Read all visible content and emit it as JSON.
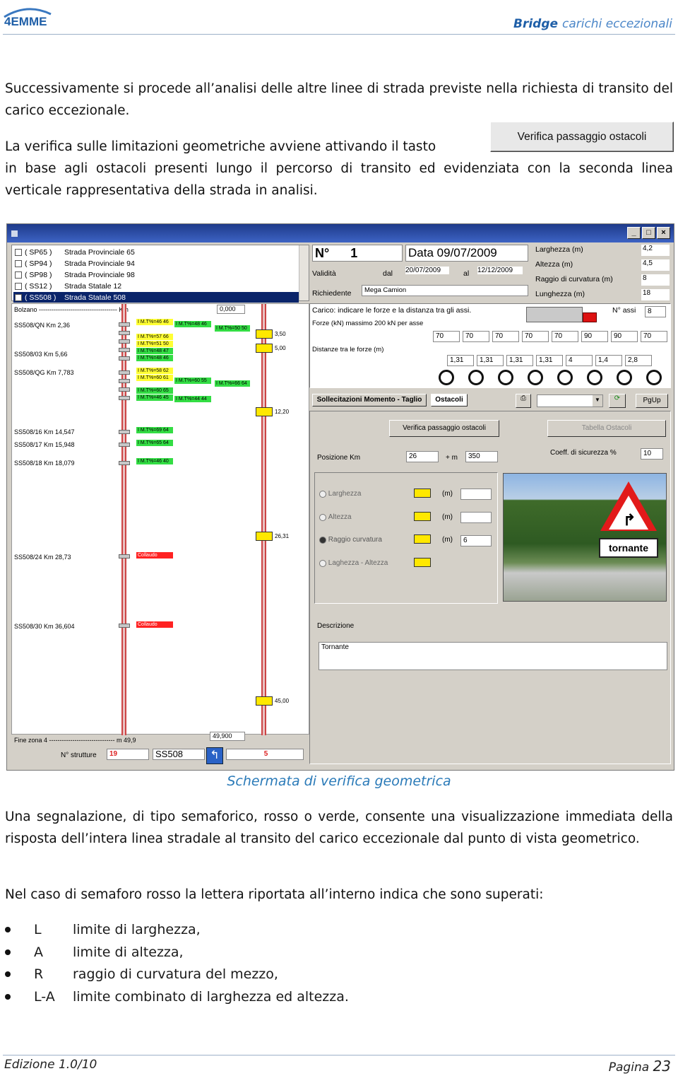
{
  "header": {
    "logo": "4EMME",
    "title_brand": "Bridge",
    "title_rest": "carichi eccezionali"
  },
  "body": {
    "p1": "Successivamente si procede all’analisi delle altre linee di strada previste nella richiesta di transito del carico eccezionale.",
    "p2a": "La verifica sulle limitazioni geometriche avviene attivando il tasto",
    "p2b": "in base agli ostacoli presenti lungo il percorso di transito ed evidenziata con la seconda linea verticale rappresentativa della strada in analisi.",
    "button_image_label": "Verifica passaggio ostacoli",
    "caption": "Schermata di verifica geometrica",
    "p3": "Una segnalazione, di tipo semaforico, rosso o verde, consente una visualizzazione immediata della risposta dell’intera linea stradale al transito del carico eccezionale dal punto di vista geometrico.",
    "p4": "Nel caso di semaforo rosso la lettera riportata all’interno indica che sono superati:",
    "bullets": [
      {
        "key": "L",
        "text": "limite di larghezza,"
      },
      {
        "key": "A",
        "text": "limite di altezza,"
      },
      {
        "key": "R",
        "text": "raggio di curvatura del mezzo,"
      },
      {
        "key": "L-A",
        "text": "limite combinato di larghezza ed altezza."
      }
    ]
  },
  "footer": {
    "edition": "Edizione 1.0/10",
    "page_label": "Pagina",
    "page_num": "23"
  },
  "screenshot": {
    "roads": [
      {
        "code": "( SP65 )",
        "name": "Strada Provinciale 65",
        "checked": false
      },
      {
        "code": "( SP94 )",
        "name": "Strada Provinciale 94",
        "checked": false
      },
      {
        "code": "( SP98 )",
        "name": "Strada Provinciale 98",
        "checked": false
      },
      {
        "code": "( SS12 )",
        "name": "Strada Statale 12",
        "checked": false
      },
      {
        "code": "( SS508 )",
        "name": "Strada Statale 508",
        "checked": true
      }
    ],
    "n_label": "N°",
    "n_value": "1",
    "data_label": "Data",
    "data_value": "09/07/2009",
    "validita": "Validità",
    "dal": "dal",
    "dal_value": "20/07/2009",
    "al": "al",
    "al_value": "12/12/2009",
    "richiedente": "Richiedente",
    "richiedente_value": "Mega Camion",
    "dims": [
      {
        "label": "Larghezza (m)",
        "value": "4,2"
      },
      {
        "label": "Altezza (m)",
        "value": "4,5"
      },
      {
        "label": "Raggio di curvatura (m)",
        "value": "8"
      },
      {
        "label": "Lunghezza (m)",
        "value": "18"
      }
    ],
    "diagram": {
      "start_label": "Bolzano ------------------------------------- Km",
      "start_value": "0,000",
      "end_label": "Fine zona 4 ------------------------------- m 49,9",
      "end_value": "49,900",
      "n_strutture": "N° strutture",
      "count_left": "19",
      "road_code": "SS508",
      "count_right": "5",
      "stations": [
        "SS508/QN  Km 2,36",
        "SS508/03  Km 5,66",
        "SS508/QG  Km 7,783",
        "SS508/16  Km 14,547",
        "SS508/17  Km 15,948",
        "SS508/18  Km 18,079",
        "SS508/24  Km 28,73",
        "SS508/30  Km 36,604"
      ],
      "tags": [
        "I M.T%=46 46",
        "I M.T%=48 46",
        "I M.T%=50 50",
        "I M.T%=57 66",
        "I M.T%=51 50",
        "I M.T%=48 47",
        "I M.T%=48 46",
        "I M.T%=58 62",
        "I M.T%=60 61",
        "I M.T%=60 55",
        "I M.T%=66 64",
        "I M.T%=60 65",
        "I M.T%=46 45",
        "I M.T%=44 44",
        "I M.T%=69 64",
        "I M.T%=65 64",
        "I M.T%=46 40",
        "Collaudo",
        "Collaudo"
      ],
      "obstacle_values": [
        "3,50",
        "5,00",
        "12,20",
        "26,31",
        "45,00"
      ]
    },
    "carico": "Carico: indicare le forze e la distanza tra gli assi.",
    "n_assi": "N° assi",
    "n_assi_value": "8",
    "forze": "Forze (kN) massimo 200 kN per asse",
    "forces": [
      "70",
      "70",
      "70",
      "70",
      "70",
      "90",
      "90",
      "70"
    ],
    "distanze": "Distanze tra le forze (m)",
    "distances": [
      "1,31",
      "1,31",
      "1,31",
      "1,31",
      "4",
      "1,4",
      "2,8"
    ],
    "tabs": [
      "Sollecitazioni Momento - Taglio",
      "Ostacoli"
    ],
    "pgup": "PgUp",
    "btn_verifica": "Verifica passaggio ostacoli",
    "btn_tabella": "Tabella Ostacoli",
    "posizione": "Posizione Km",
    "pos_km": "26",
    "pos_plus": "+ m",
    "pos_m": "350",
    "coeff": "Coeff. di sicurezza %",
    "coeff_value": "10",
    "options": [
      {
        "label": "Larghezza",
        "unit": "(m)",
        "value": ""
      },
      {
        "label": "Altezza",
        "unit": "(m)",
        "value": ""
      },
      {
        "label": "Raggio curvatura",
        "unit": "(m)",
        "value": "6"
      },
      {
        "label": "Laghezza - Altezza",
        "unit": "",
        "value": ""
      }
    ],
    "sign_text": "tornante",
    "descrizione": "Descrizione",
    "descrizione_value": "Tornante"
  },
  "colors": {
    "header_blue": "#3a78c0",
    "caption_blue": "#2a7ab8",
    "titlebar": "#1e3a8a",
    "yellow": "#ffff33",
    "green": "#33dd44",
    "red": "#ff2222"
  }
}
